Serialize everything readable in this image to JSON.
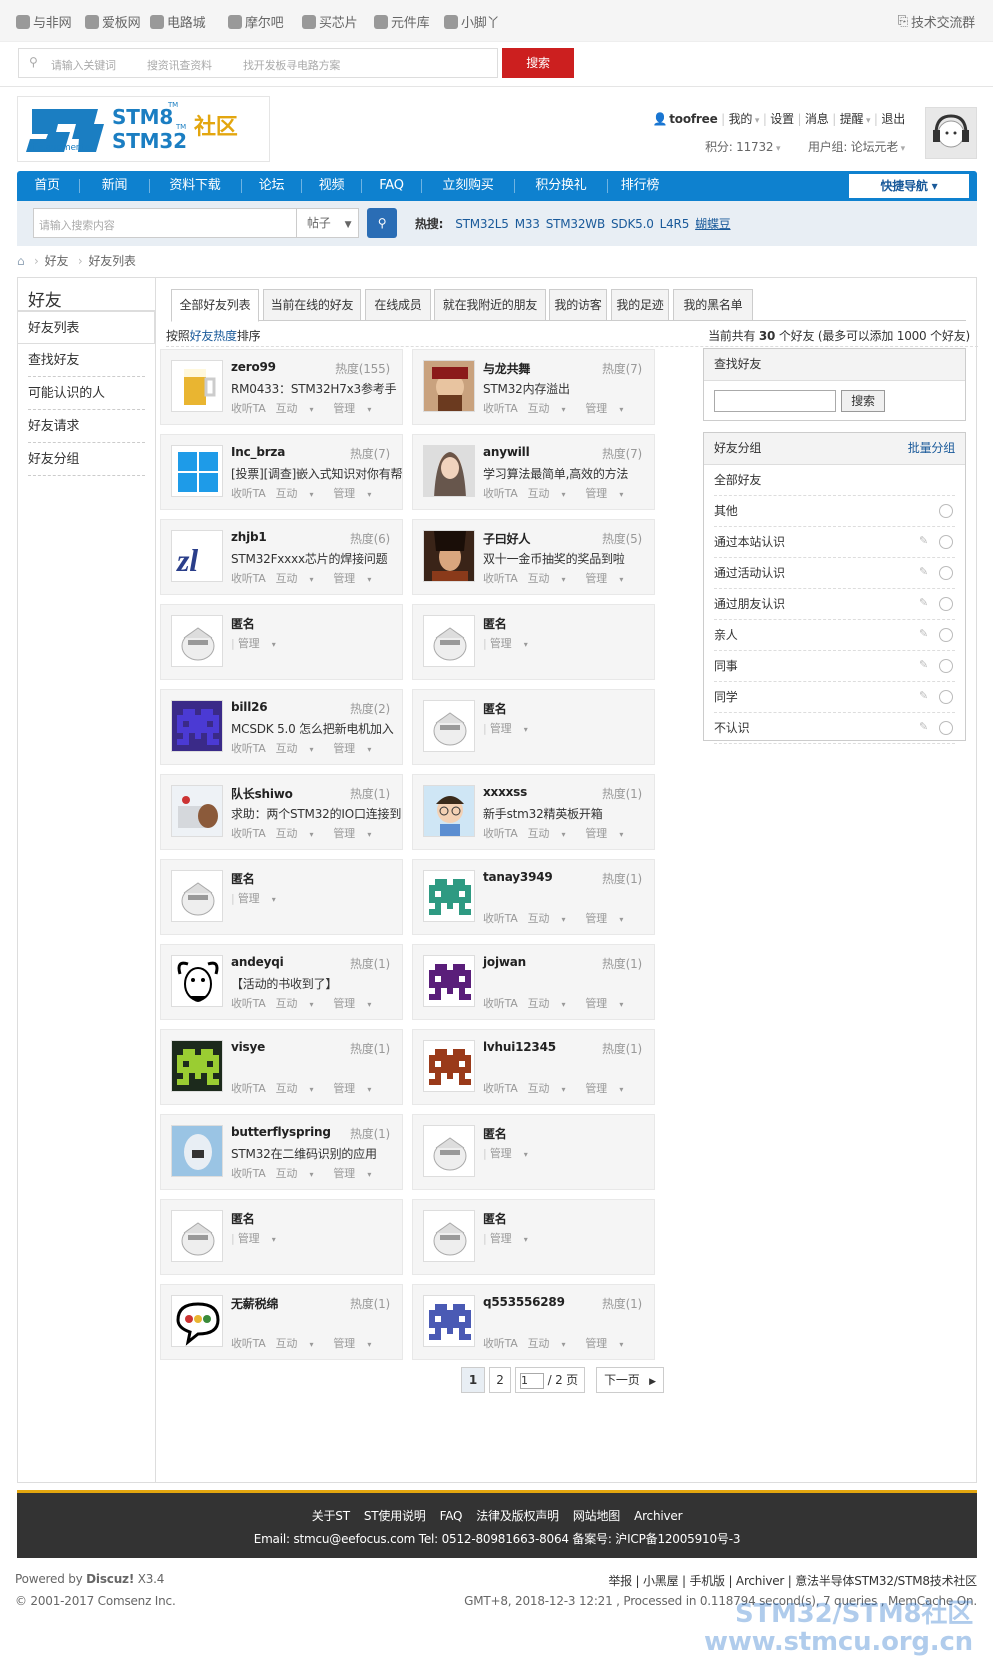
{
  "topnav": {
    "sites": [
      "与非网",
      "爱板网",
      "电路城",
      "摩尔吧",
      "买芯片",
      "元件库",
      "小脚丫"
    ],
    "right": "技术交流群"
  },
  "search": {
    "tabs": [
      "请输入关键词",
      "搜资讯查资料",
      "找开发板寻电路方案"
    ],
    "button": "搜索"
  },
  "logo": {
    "brand1": "STM8",
    "brand2": "STM32",
    "tm": "TM",
    "community": "社区",
    "tagline": "life.augmented"
  },
  "user": {
    "name": "toofree",
    "my": "我的",
    "settings": "设置",
    "messages": "消息",
    "remind": "提醒",
    "logout": "退出",
    "points": "积分: 11732",
    "group": "用户组: 论坛元老"
  },
  "nav": {
    "items": [
      "首页",
      "新闻",
      "资料下载",
      "论坛",
      "视频",
      "FAQ",
      "立刻购买",
      "积分换礼",
      "排行榜"
    ],
    "quick": "快捷导航"
  },
  "subsearch": {
    "placeholder": "请输入搜索内容",
    "select": "帖子",
    "hot_label": "热搜:",
    "hot": [
      "STM32L5",
      "M33",
      "STM32WB",
      "SDK5.0",
      "L4R5",
      "蝴蝶豆"
    ]
  },
  "breadcrumb": [
    "好友",
    "好友列表"
  ],
  "sidebar": {
    "title": "好友",
    "items": [
      "好友列表",
      "查找好友",
      "可能认识的人",
      "好友请求",
      "好友分组"
    ]
  },
  "tabs": [
    "全部好友列表",
    "当前在线的好友",
    "在线成员",
    "就在我附近的朋友",
    "我的访客",
    "我的足迹",
    "我的黑名单"
  ],
  "sort": {
    "prefix": "按照",
    "link": "好友热度",
    "suffix": "排序",
    "total_pre": "当前共有",
    "count": "30",
    "total_suf": "个好友 (最多可以添加 1000 个好友)"
  },
  "actions": {
    "listen": "收听TA",
    "interact": "互动",
    "manage": "管理"
  },
  "friends": [
    {
      "name": "zero99",
      "hot": "热度(155)",
      "status": "RM0433：STM32H7x3参考手",
      "av": "beer"
    },
    {
      "name": "与龙共舞",
      "hot": "热度(7)",
      "status": "STM32内存溢出",
      "av": "face1"
    },
    {
      "name": "Inc_brza",
      "hot": "热度(7)",
      "status": "[投票][调查]嵌入式知识对你有帮",
      "av": "win"
    },
    {
      "name": "anywill",
      "hot": "热度(7)",
      "status": "学习算法最简单,高效的方法",
      "av": "face2"
    },
    {
      "name": "zhjb1",
      "hot": "热度(6)",
      "status": "STM32Fxxxx芯片的焊接问题",
      "av": "zl"
    },
    {
      "name": "子曰好人",
      "hot": "热度(5)",
      "status": "双十一金币抽奖的奖品到啦",
      "av": "face3"
    },
    {
      "name": "匿名",
      "hot": "",
      "status": "",
      "av": "anon"
    },
    {
      "name": "匿名",
      "hot": "",
      "status": "",
      "av": "anon"
    },
    {
      "name": "bill26",
      "hot": "热度(2)",
      "status": "MCSDK 5.0 怎么把新电机加入",
      "av": "px1"
    },
    {
      "name": "匿名",
      "hot": "",
      "status": "",
      "av": "anon"
    },
    {
      "name": "队长shiwo",
      "hot": "热度(1)",
      "status": "求助：两个STM32的IO口连接到",
      "av": "face4"
    },
    {
      "name": "xxxxss",
      "hot": "热度(1)",
      "status": "新手stm32精英板开箱",
      "av": "face5"
    },
    {
      "name": "匿名",
      "hot": "",
      "status": "",
      "av": "anon"
    },
    {
      "name": "tanay3949",
      "hot": "热度(1)",
      "status": "",
      "av": "px2"
    },
    {
      "name": "andeyqi",
      "hot": "热度(1)",
      "status": "【活动的书收到了】",
      "av": "gnu"
    },
    {
      "name": "jojwan",
      "hot": "热度(1)",
      "status": "",
      "av": "px3"
    },
    {
      "name": "visye",
      "hot": "热度(1)",
      "status": "",
      "av": "px4"
    },
    {
      "name": "lvhui12345",
      "hot": "热度(1)",
      "status": "",
      "av": "px5"
    },
    {
      "name": "butterflyspring",
      "hot": "热度(1)",
      "status": "STM32在二维码识别的应用",
      "av": "face6"
    },
    {
      "name": "匿名",
      "hot": "",
      "status": "",
      "av": "anon"
    },
    {
      "name": "匿名",
      "hot": "",
      "status": "",
      "av": "anon"
    },
    {
      "name": "匿名",
      "hot": "",
      "status": "",
      "av": "anon"
    },
    {
      "name": "无薪税绵",
      "hot": "热度(1)",
      "status": "",
      "av": "chat"
    },
    {
      "name": "q553556289",
      "hot": "热度(1)",
      "status": "",
      "av": "px6"
    }
  ],
  "find": {
    "title": "查找好友",
    "button": "搜索"
  },
  "groups": {
    "title": "好友分组",
    "batch": "批量分组",
    "items": [
      "全部好友",
      "其他",
      "通过本站认识",
      "通过活动认识",
      "通过朋友认识",
      "亲人",
      "同事",
      "同学",
      "不认识"
    ]
  },
  "pager": {
    "p1": "1",
    "p2": "2",
    "input": "1",
    "total": "/ 2 页",
    "next": "下一页"
  },
  "footer": {
    "links": [
      "关于ST",
      "ST使用说明",
      "FAQ",
      "法律及版权声明",
      "网站地图",
      "Archiver"
    ],
    "contact": "Email:  stmcu@eefocus.com   Tel: 0512-80981663-8064 备案号: 沪ICP备12005910号-3"
  },
  "bottom": {
    "powered": "Powered by ",
    "discuz": "Discuz!",
    "ver": " X3.4",
    "copyright": "© 2001-2017 Comsenz Inc.",
    "links": "举报 | 小黑屋 | 手机版 | Archiver | 意法半导体STM32/STM8技术社区",
    "gmt": "GMT+8, 2018-12-3 12:21 , Processed in 0.118794 second(s), 7 queries , MemCache On."
  },
  "watermark": [
    "STM32/STM8社区",
    "www.stmcu.org.cn"
  ],
  "colors": {
    "nav": "#0e81cf",
    "search_btn": "#cc1f1f",
    "footer_line": "#e3a60f"
  }
}
